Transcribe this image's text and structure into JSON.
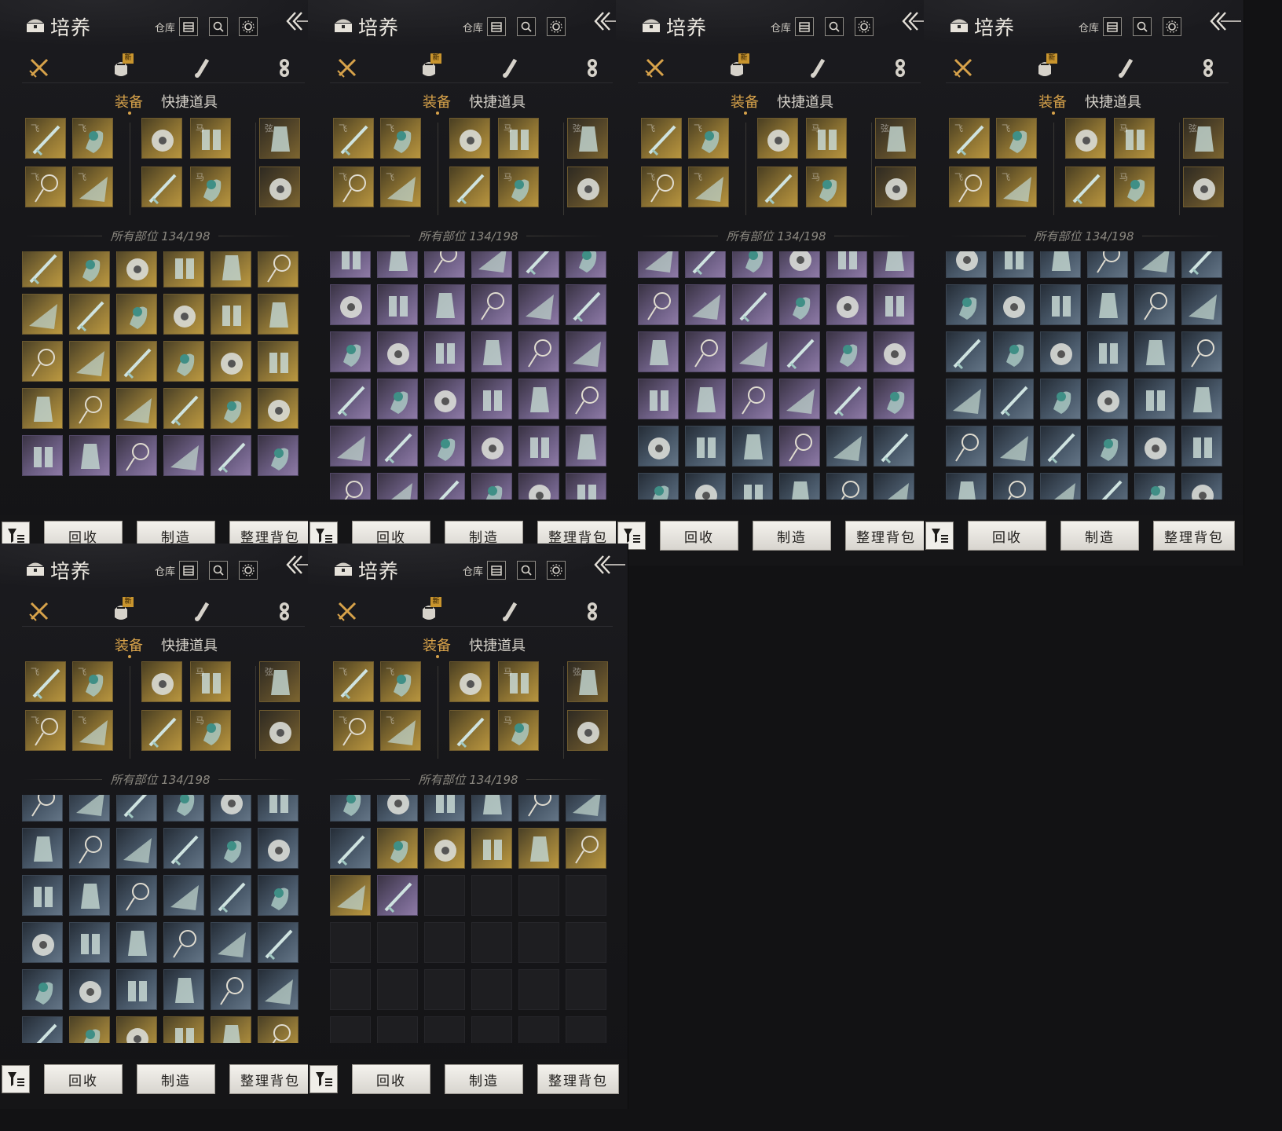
{
  "header": {
    "title": "培养",
    "warehouse_label": "仓库"
  },
  "category_tabs": [
    {
      "icon": "crossed-swords-icon",
      "active": true,
      "badge": ""
    },
    {
      "icon": "pouch-icon",
      "active": false,
      "badge": "新"
    },
    {
      "icon": "scroll-icon",
      "active": false,
      "badge": ""
    },
    {
      "icon": "gem-icon",
      "active": false,
      "badge": ""
    }
  ],
  "sub_tabs": {
    "equipment": "装备",
    "quick_items": "快捷道具"
  },
  "equipped_glyphs": [
    "飞",
    "飞",
    "",
    "马",
    "弦",
    "飞",
    "飞",
    "",
    "马",
    ""
  ],
  "inventory_count": "所有部位 134/198",
  "buttons": {
    "recycle": "回收",
    "craft": "制造",
    "sort": "整理背包"
  },
  "colors": {
    "gold_rarity": "#b8953f",
    "purple_rarity": "#8e7aa6",
    "blue_rarity": "#647586",
    "accent": "#d7a24a",
    "badge_new": "#c9952e"
  },
  "panels": [
    {
      "grid": [
        [
          "gold",
          "gold",
          "gold",
          "gold",
          "gold",
          "gold"
        ],
        [
          "gold",
          "gold",
          "gold",
          "gold",
          "gold",
          "gold"
        ],
        [
          "gold",
          "gold",
          "gold",
          "gold",
          "gold",
          "gold"
        ],
        [
          "gold",
          "gold",
          "gold",
          "gold",
          "gold",
          "gold"
        ],
        [
          "purple",
          "purple",
          "purple",
          "purple",
          "purple",
          "purple"
        ]
      ]
    },
    {
      "grid": [
        [
          "purple",
          "purple",
          "purple",
          "purple",
          "purple",
          "purple"
        ],
        [
          "purple",
          "purple",
          "purple",
          "purple",
          "purple",
          "purple"
        ],
        [
          "purple",
          "purple",
          "purple",
          "purple",
          "purple",
          "purple"
        ],
        [
          "purple",
          "purple",
          "purple",
          "purple",
          "purple",
          "purple"
        ],
        [
          "purple",
          "purple",
          "purple",
          "purple",
          "purple",
          "purple"
        ],
        [
          "purple",
          "purple",
          "purple",
          "purple",
          "purple",
          "purple"
        ]
      ]
    },
    {
      "grid": [
        [
          "purple",
          "purple",
          "purple",
          "purple",
          "purple",
          "purple"
        ],
        [
          "purple",
          "purple",
          "purple",
          "purple",
          "purple",
          "purple"
        ],
        [
          "purple",
          "purple",
          "purple",
          "purple",
          "purple",
          "purple"
        ],
        [
          "purple",
          "purple",
          "purple",
          "purple",
          "purple",
          "purple"
        ],
        [
          "blue",
          "blue",
          "blue",
          "purple",
          "blue",
          "blue"
        ],
        [
          "blue",
          "blue",
          "blue",
          "blue",
          "blue",
          "blue"
        ]
      ]
    },
    {
      "grid": [
        [
          "blue",
          "blue",
          "blue",
          "blue",
          "blue",
          "blue"
        ],
        [
          "blue",
          "blue",
          "blue",
          "blue",
          "blue",
          "blue"
        ],
        [
          "blue",
          "blue",
          "blue",
          "blue",
          "blue",
          "blue"
        ],
        [
          "blue",
          "blue",
          "blue",
          "blue",
          "blue",
          "blue"
        ],
        [
          "blue",
          "blue",
          "blue",
          "blue",
          "blue",
          "blue"
        ],
        [
          "blue",
          "blue",
          "blue",
          "blue",
          "blue",
          "blue"
        ]
      ]
    },
    {
      "grid": [
        [
          "blue",
          "blue",
          "blue",
          "blue",
          "blue",
          "blue"
        ],
        [
          "blue",
          "blue",
          "blue",
          "blue",
          "blue",
          "blue"
        ],
        [
          "blue",
          "blue",
          "blue",
          "blue",
          "blue",
          "blue"
        ],
        [
          "blue",
          "blue",
          "blue",
          "blue",
          "blue",
          "blue"
        ],
        [
          "blue",
          "blue",
          "blue",
          "blue",
          "blue",
          "blue"
        ],
        [
          "blue",
          "gold",
          "gold",
          "gold",
          "gold",
          "gold"
        ]
      ]
    },
    {
      "grid": [
        [
          "blue",
          "blue",
          "blue",
          "blue",
          "blue",
          "blue"
        ],
        [
          "blue",
          "gold",
          "gold",
          "gold",
          "gold",
          "gold"
        ],
        [
          "gold",
          "purple",
          "empty",
          "empty",
          "empty",
          "empty"
        ],
        [
          "empty",
          "empty",
          "empty",
          "empty",
          "empty",
          "empty"
        ],
        [
          "empty",
          "empty",
          "empty",
          "empty",
          "empty",
          "empty"
        ],
        [
          "empty",
          "empty",
          "empty",
          "empty",
          "empty",
          "empty"
        ]
      ]
    }
  ]
}
